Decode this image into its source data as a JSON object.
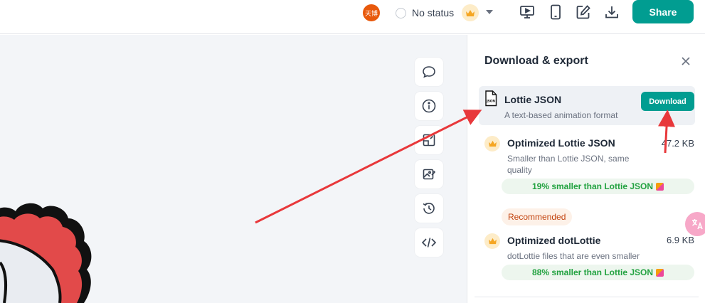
{
  "topbar": {
    "avatar_text": "天博",
    "status_label": "No status",
    "share_label": "Share",
    "icons": [
      "present-icon",
      "mobile-preview-icon",
      "edit-icon",
      "download-icon",
      "crown-icon",
      "chevron-down-icon"
    ]
  },
  "toolbar": {
    "items": [
      "comment-icon",
      "info-icon",
      "edit-layers-icon",
      "image-edit-icon",
      "history-icon",
      "code-icon"
    ]
  },
  "export_panel": {
    "title": "Download & export",
    "options": [
      {
        "name": "Lottie JSON",
        "description": "A text-based animation format",
        "action_label": "Download",
        "file_icon_text": "JSON"
      },
      {
        "name": "Optimized Lottie JSON",
        "description": "Smaller than Lottie JSON, same quality",
        "size": "47.2 KB",
        "savings": "19% smaller than Lottie JSON"
      },
      {
        "name": "Optimized dotLottie",
        "description": "dotLottie files that are even smaller",
        "size": "6.9 KB",
        "savings": "88% smaller than Lottie JSON",
        "badge": "Recommended"
      }
    ]
  },
  "colors": {
    "accent": "#019d91",
    "savings_text": "#22a240",
    "annotation_arrow": "#e8383b",
    "crown": "#f5a623"
  }
}
